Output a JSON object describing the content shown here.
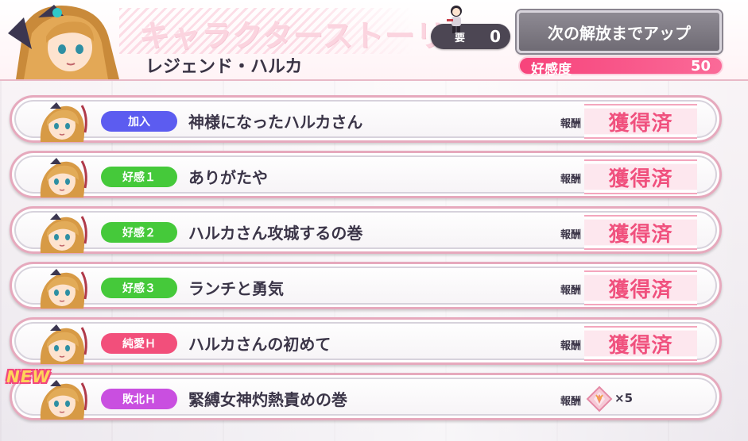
{
  "header": {
    "title": "キャラクターストーリー",
    "subtitle": "レジェンド・ハルカ",
    "ticket_label": "要",
    "ticket_count": "0",
    "unlock_button_label": "次の解放までアップ",
    "affinity_label": "好感度",
    "affinity_value": "50"
  },
  "colors": {
    "join": "#5c5cf0",
    "affinity": "#45c93a",
    "pure_love": "#f24f7b",
    "defeat": "#c94fe0",
    "obtained": "#f0517e"
  },
  "stories": [
    {
      "badge": "加入",
      "badge_color": "#5c5cf0",
      "title": "神様になったハルカさん",
      "reward_label": "報酬",
      "status": "獲得済"
    },
    {
      "badge": "好感１",
      "badge_color": "#45c93a",
      "title": "ありがたや",
      "reward_label": "報酬",
      "status": "獲得済"
    },
    {
      "badge": "好感２",
      "badge_color": "#45c93a",
      "title": "ハルカさん攻城するの巻",
      "reward_label": "報酬",
      "status": "獲得済"
    },
    {
      "badge": "好感３",
      "badge_color": "#45c93a",
      "title": "ランチと勇気",
      "reward_label": "報酬",
      "status": "獲得済"
    },
    {
      "badge": "純愛Ｈ",
      "badge_color": "#f24f7b",
      "title": "ハルカさんの初めて",
      "reward_label": "報酬",
      "status": "獲得済"
    },
    {
      "badge": "敗北Ｈ",
      "badge_color": "#c94fe0",
      "title": "緊縛女神灼熱責めの巻",
      "reward_label": "報酬",
      "reward_icon": "crystal-gem-icon",
      "reward_qty": "×5",
      "new_tag": "NEW"
    }
  ]
}
